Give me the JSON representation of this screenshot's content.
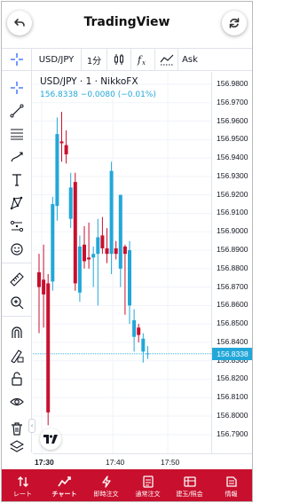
{
  "header": {
    "title": "TradingView",
    "back_icon": "back-arrow-icon",
    "refresh_icon": "refresh-icon"
  },
  "toolbar": {
    "symbol": "USD/JPY",
    "interval": "1分",
    "candles_icon": "candlestick-icon",
    "fx_icon": "fx-indicator-icon",
    "compare_icon": "compare-icon",
    "price_side": "Ask"
  },
  "legend": {
    "line1": "USD/JPY · 1 · NikkoFX",
    "line2": "156.8338  −0.0080 (−0.01%)"
  },
  "left_tools": [
    "crosshair-icon",
    "trendline-icon",
    "fib-icon",
    "brush-icon",
    "text-icon",
    "pattern-icon",
    "prediction-icon",
    "emoji-icon",
    "ruler-icon",
    "zoom-icon",
    "magnet-icon",
    "lock-draw-icon",
    "lock-icon",
    "eye-icon",
    "trash-icon",
    "layers-icon"
  ],
  "colors": {
    "up": "#22a7d9",
    "down": "#c8102e",
    "nav_bg": "#c8102e",
    "price_label": "#22a7d9"
  },
  "chart_data": {
    "type": "candlestick",
    "y_ticks": [
      "156.9800",
      "156.9700",
      "156.9600",
      "156.9500",
      "156.9400",
      "156.9300",
      "156.9200",
      "156.9100",
      "156.9000",
      "156.8900",
      "156.8800",
      "156.8700",
      "156.8600",
      "156.8500",
      "156.8400",
      "156.8300",
      "156.8200",
      "156.8100",
      "156.8000",
      "156.7900"
    ],
    "ylim": [
      156.785,
      156.985
    ],
    "current_price": "156.8338",
    "x_ticks": [
      "17:30",
      "17:40",
      "17:50"
    ],
    "candles": [
      {
        "o": 156.878,
        "h": 156.888,
        "l": 156.845,
        "c": 156.87
      },
      {
        "o": 156.874,
        "h": 156.893,
        "l": 156.848,
        "c": 156.866
      },
      {
        "o": 156.872,
        "h": 156.877,
        "l": 156.795,
        "c": 156.802
      },
      {
        "o": 156.873,
        "h": 156.919,
        "l": 156.868,
        "c": 156.915
      },
      {
        "o": 156.914,
        "h": 156.962,
        "l": 156.906,
        "c": 156.953
      },
      {
        "o": 156.949,
        "h": 156.965,
        "l": 156.938,
        "c": 156.948
      },
      {
        "o": 156.947,
        "h": 156.955,
        "l": 156.937,
        "c": 156.942
      },
      {
        "o": 156.907,
        "h": 156.932,
        "l": 156.902,
        "c": 156.924
      },
      {
        "o": 156.927,
        "h": 156.932,
        "l": 156.868,
        "c": 156.872
      },
      {
        "o": 156.867,
        "h": 156.898,
        "l": 156.862,
        "c": 156.892
      },
      {
        "o": 156.893,
        "h": 156.903,
        "l": 156.88,
        "c": 156.884
      },
      {
        "o": 156.886,
        "h": 156.905,
        "l": 156.88,
        "c": 156.885
      },
      {
        "o": 156.886,
        "h": 156.892,
        "l": 156.87,
        "c": 156.888
      },
      {
        "o": 156.888,
        "h": 156.907,
        "l": 156.86,
        "c": 156.897
      },
      {
        "o": 156.898,
        "h": 156.908,
        "l": 156.888,
        "c": 156.891
      },
      {
        "o": 156.891,
        "h": 156.902,
        "l": 156.883,
        "c": 156.888
      },
      {
        "o": 156.888,
        "h": 156.938,
        "l": 156.877,
        "c": 156.933
      },
      {
        "o": 156.891,
        "h": 156.895,
        "l": 156.885,
        "c": 156.888
      },
      {
        "o": 156.88,
        "h": 156.92,
        "l": 156.87,
        "c": 156.92
      },
      {
        "o": 156.892,
        "h": 156.893,
        "l": 156.855,
        "c": 156.888
      },
      {
        "o": 156.86,
        "h": 156.895,
        "l": 156.85,
        "c": 156.89
      },
      {
        "o": 156.843,
        "h": 156.858,
        "l": 156.835,
        "c": 156.852
      },
      {
        "o": 156.848,
        "h": 156.85,
        "l": 156.84,
        "c": 156.844
      },
      {
        "o": 156.835,
        "h": 156.845,
        "l": 156.829,
        "c": 156.842
      },
      {
        "o": 156.834,
        "h": 156.838,
        "l": 156.831,
        "c": 156.834
      }
    ]
  },
  "bottom_nav": [
    {
      "label": "レート",
      "icon": "rate-sort-icon",
      "active": false
    },
    {
      "label": "チャート",
      "icon": "chart-icon",
      "active": true
    },
    {
      "label": "即時注文",
      "icon": "instant-order-icon",
      "active": false
    },
    {
      "label": "通常注文",
      "icon": "normal-order-icon",
      "active": false
    },
    {
      "label": "建玉/照会",
      "icon": "position-icon",
      "active": false
    },
    {
      "label": "情報",
      "icon": "info-icon",
      "active": false
    }
  ]
}
